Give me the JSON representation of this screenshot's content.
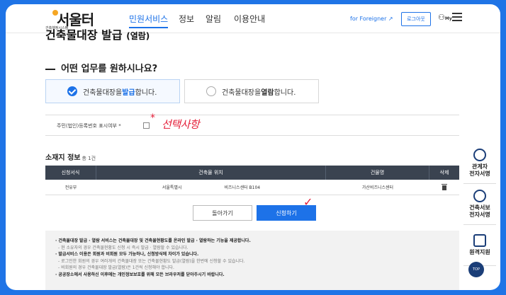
{
  "header": {
    "logo_main": "서울터",
    "logo_sub": "건축행정시스템",
    "nav": [
      "민원서비스",
      "정보",
      "알림",
      "이용안내"
    ],
    "foreigner": "for Foreigner",
    "logout": "로그아웃",
    "my": "My"
  },
  "page": {
    "title": "건축물대장 발급",
    "title_suffix": "(열람)",
    "question": "어떤 업무를 원하시나요?"
  },
  "options": {
    "issue": {
      "prefix": "건축물대장을 ",
      "keyword": "발급",
      "suffix": "합니다.",
      "selected": true
    },
    "view": {
      "prefix": "건축물대장을 ",
      "keyword": "열람",
      "suffix": "합니다.",
      "selected": false
    }
  },
  "id_display": {
    "label": "주민(법인)등록번호 표시여부 *",
    "annotation": "선택사항",
    "annotation_star": "*"
  },
  "table": {
    "title": "소재지 정보",
    "count": "총 1건",
    "headers": [
      "신청서식",
      "건축물 위치",
      "건물명",
      "삭제"
    ],
    "rows": [
      {
        "form": "전유부",
        "loc_a": "서울특별시",
        "loc_b": "비즈니스센터 B104",
        "name": "가산비즈니스센터"
      }
    ]
  },
  "buttons": {
    "back": "돌아가기",
    "apply": "신청하기",
    "annotation_check": "✓"
  },
  "notice": [
    {
      "text": "· 건축물대장 발급 · 열람 서비스는 건축물대장 및 건축물현황도를 온라인 발급 · 열람하는 기능을 제공합니다.",
      "style": "b"
    },
    {
      "text": "- 현 소유자의 경우 건축물현황도 신청 시 즉시 발급 · 열람할 수 있습니다.",
      "style": "sub"
    },
    {
      "text": "· 발급서비스 이용은 회원과 비회원 모두 가능하나, 신청방식에 차이가 있습니다.",
      "style": "b"
    },
    {
      "text": "- 로그인한 회원의 경우 여러개의 건축물대장 또는 건축물현황도 발급(열람)을 한번에 신청할 수 있습니다.",
      "style": "sub"
    },
    {
      "text": "- 비회원의 경우 건축물대장 발급(열람)은 1건씩 신청해야 합니다.",
      "style": "sub"
    },
    {
      "text": "· 공공장소에서 사용하신 이후에는 개인정보보호를 위해 모든 브라우저를 닫아주시기 바랍니다.",
      "style": "b"
    }
  ],
  "side": {
    "items": [
      {
        "label_1": "관계자",
        "label_2": "전자서명"
      },
      {
        "label_1": "건축서보",
        "label_2": "전자서명"
      },
      {
        "label_1": "원격지원",
        "label_2": ""
      }
    ],
    "top": "TOP"
  },
  "colors": {
    "accent": "#1d72e8",
    "table_header": "#3a4350",
    "annotation": "#e5203a",
    "frame": "#1f74e6"
  }
}
